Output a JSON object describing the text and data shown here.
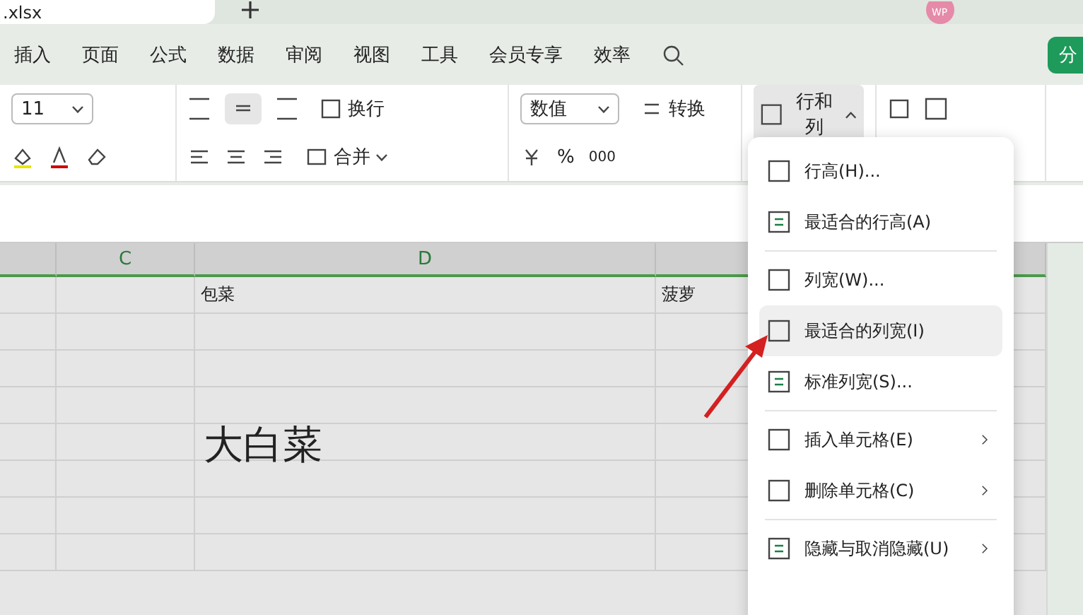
{
  "file_tab": {
    "title": ".xlsx"
  },
  "menu_tabs": [
    {
      "label": "插入",
      "selected": false
    },
    {
      "label": "页面",
      "selected": false
    },
    {
      "label": "公式",
      "selected": false
    },
    {
      "label": "数据",
      "selected": false
    },
    {
      "label": "审阅",
      "selected": false
    },
    {
      "label": "视图",
      "selected": false
    },
    {
      "label": "工具",
      "selected": false
    },
    {
      "label": "会员专享",
      "selected": false
    },
    {
      "label": "效率",
      "selected": false
    }
  ],
  "avatar": {
    "initials": "WP"
  },
  "share_button": {
    "label": "分"
  },
  "ribbon": {
    "font_size": "11",
    "wrap_label": "换行",
    "merge_label": "合并",
    "number_format": "数值",
    "convert_label": "转换",
    "percent": "%",
    "thousands": "000",
    "row_col_button": {
      "label": "行和列",
      "expanded": true
    }
  },
  "sheet": {
    "columns": [
      "",
      "C",
      "D",
      ""
    ],
    "rows": [
      [
        "",
        "",
        "包菜",
        "菠萝"
      ],
      [
        "",
        "",
        "",
        ""
      ],
      [
        "",
        "",
        "",
        ""
      ],
      [
        "",
        "",
        "",
        ""
      ],
      [
        "",
        "",
        "大白菜",
        ""
      ],
      [
        "",
        "",
        "",
        ""
      ],
      [
        "",
        "",
        "",
        ""
      ],
      [
        "",
        "",
        "",
        ""
      ]
    ]
  },
  "dropdown": {
    "items": [
      {
        "kind": "item",
        "label": "行高(H)...",
        "selected": false,
        "submenu": false
      },
      {
        "kind": "item",
        "label": "最适合的行高(A)",
        "selected": false,
        "submenu": false
      },
      {
        "kind": "separator"
      },
      {
        "kind": "item",
        "label": "列宽(W)...",
        "selected": false,
        "submenu": false
      },
      {
        "kind": "item",
        "label": "最适合的列宽(I)",
        "selected": true,
        "submenu": false
      },
      {
        "kind": "item",
        "label": "标准列宽(S)...",
        "selected": false,
        "submenu": false
      },
      {
        "kind": "separator"
      },
      {
        "kind": "item",
        "label": "插入单元格(E)",
        "selected": false,
        "submenu": true
      },
      {
        "kind": "item",
        "label": "删除单元格(C)",
        "selected": false,
        "submenu": true
      },
      {
        "kind": "separator"
      },
      {
        "kind": "item",
        "label": "隐藏与取消隐藏(U)",
        "selected": false,
        "submenu": true
      }
    ]
  }
}
